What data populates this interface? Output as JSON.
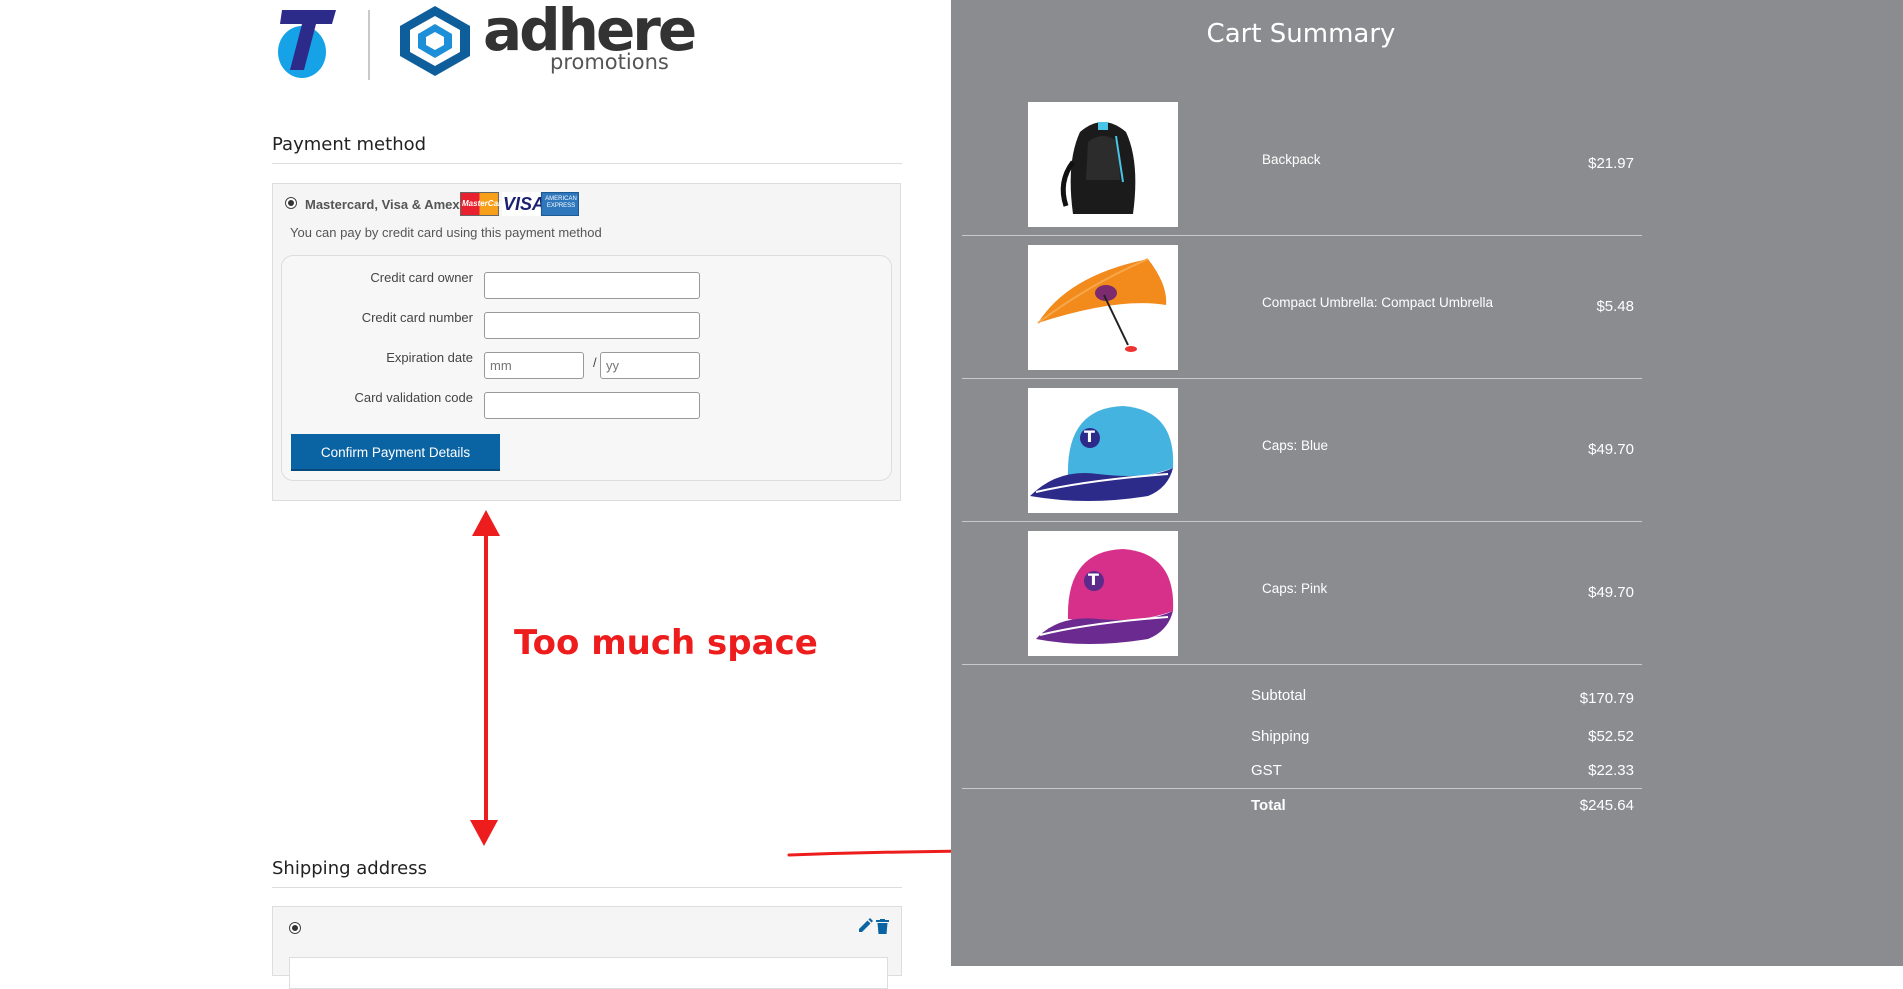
{
  "header": {
    "logo_t_letter": "T",
    "brand_main": "adhere",
    "brand_sub": "promotions"
  },
  "payment": {
    "section_title": "Payment method",
    "method_label": "Mastercard, Visa & Amex",
    "card_logos": [
      "MasterCard",
      "VISA",
      "AMERICAN EXPRESS"
    ],
    "description": "You can pay by credit card using this payment method",
    "fields": {
      "owner_label": "Credit card owner",
      "number_label": "Credit card number",
      "expiry_label": "Expiration date",
      "expiry_month_placeholder": "mm",
      "expiry_separator": "/",
      "expiry_year_placeholder": "yy",
      "cvv_label": "Card validation code"
    },
    "confirm_button": "Confirm Payment Details"
  },
  "shipping": {
    "section_title": "Shipping address"
  },
  "annotation": {
    "text": "Too much space",
    "color": "#ee1d1d"
  },
  "cart": {
    "title": "Cart Summary",
    "items": [
      {
        "name": "Backpack",
        "price": "$21.97",
        "image": "backpack"
      },
      {
        "name": "Compact Umbrella: Compact Umbrella",
        "price": "$5.48",
        "image": "umbrella-orange"
      },
      {
        "name": "Caps: Blue",
        "price": "$49.70",
        "image": "cap-blue"
      },
      {
        "name": "Caps: Pink",
        "price": "$49.70",
        "image": "cap-pink"
      }
    ],
    "subtotal_label": "Subtotal",
    "subtotal_value": "$170.79",
    "shipping_label": "Shipping",
    "shipping_value": "$52.52",
    "gst_label": "GST",
    "gst_value": "$22.33",
    "total_label": "Total",
    "total_value": "$245.64"
  },
  "colors": {
    "panel_bg": "#8b8c90",
    "button_blue": "#0a64a4",
    "brand_blue": "#1d8fd8"
  }
}
